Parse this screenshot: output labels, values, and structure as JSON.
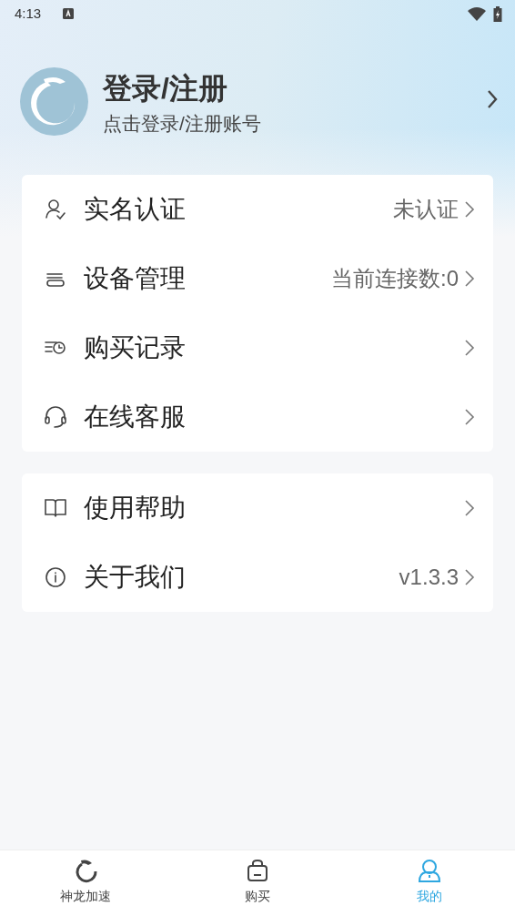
{
  "status_bar": {
    "time": "4:13"
  },
  "profile": {
    "title": "登录/注册",
    "subtitle": "点击登录/注册账号"
  },
  "menu_groups": [
    {
      "items": [
        {
          "label": "实名认证",
          "value": "未认证"
        },
        {
          "label": "设备管理",
          "value": "当前连接数:0"
        },
        {
          "label": "购买记录"
        },
        {
          "label": "在线客服"
        }
      ]
    },
    {
      "items": [
        {
          "label": "使用帮助"
        },
        {
          "label": "关于我们",
          "value": "v1.3.3"
        }
      ]
    }
  ],
  "bottom_nav": [
    {
      "label": "神龙加速",
      "selected": false
    },
    {
      "label": "购买",
      "selected": false
    },
    {
      "label": "我的",
      "selected": true
    }
  ]
}
